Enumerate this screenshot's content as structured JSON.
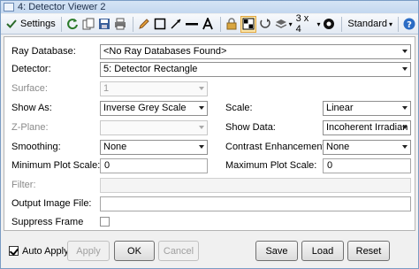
{
  "window": {
    "title": "4: Detector Viewer 2"
  },
  "toolbar": {
    "settings_label": "Settings",
    "layout_label": "3 x 4",
    "standard_label": "Standard"
  },
  "form": {
    "ray_database": {
      "label": "Ray Database:",
      "value": "<No Ray Databases Found>"
    },
    "detector": {
      "label": "Detector:",
      "value": "5: Detector Rectangle"
    },
    "surface": {
      "label": "Surface:",
      "value": "1"
    },
    "show_as": {
      "label": "Show As:",
      "value": "Inverse Grey Scale"
    },
    "scale": {
      "label": "Scale:",
      "value": "Linear"
    },
    "z_plane": {
      "label": "Z-Plane:",
      "value": ""
    },
    "show_data": {
      "label": "Show Data:",
      "value": "Incoherent Irradian"
    },
    "smoothing": {
      "label": "Smoothing:",
      "value": "None"
    },
    "contrast": {
      "label": "Contrast Enhancement:",
      "value": "None"
    },
    "min_plot_scale": {
      "label": "Minimum Plot Scale:",
      "value": "0"
    },
    "max_plot_scale": {
      "label": "Maximum Plot Scale:",
      "value": "0"
    },
    "filter": {
      "label": "Filter:",
      "value": ""
    },
    "output_image_file": {
      "label": "Output Image File:",
      "value": ""
    },
    "suppress_frame": {
      "label": "Suppress Frame",
      "checked": false
    }
  },
  "footer": {
    "auto_apply_label": "Auto Apply",
    "auto_apply_checked": true,
    "apply_label": "Apply",
    "ok_label": "OK",
    "cancel_label": "Cancel",
    "save_label": "Save",
    "load_label": "Load",
    "reset_label": "Reset"
  },
  "colors": {
    "accent": "#f0a030",
    "help": "#2b6cc4",
    "title_bar": "#c9dcf2"
  }
}
